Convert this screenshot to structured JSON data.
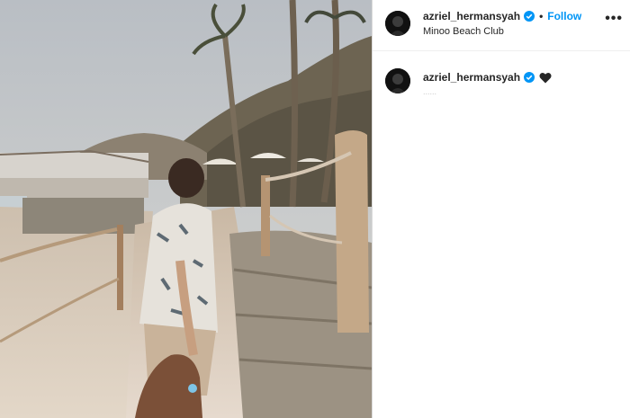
{
  "post": {
    "username": "azriel_hermansyah",
    "follow_label": "Follow",
    "separator": "•",
    "location": "Minoo Beach Club",
    "more_label": "•••",
    "verified_color": "#0095f6",
    "follow_color": "#0095f6"
  },
  "caption": {
    "username": "azriel_hermansyah",
    "emoji": "black-heart-icon",
    "trailing": "......"
  },
  "photo": {
    "description_icon": "beach-walkway-photo"
  }
}
